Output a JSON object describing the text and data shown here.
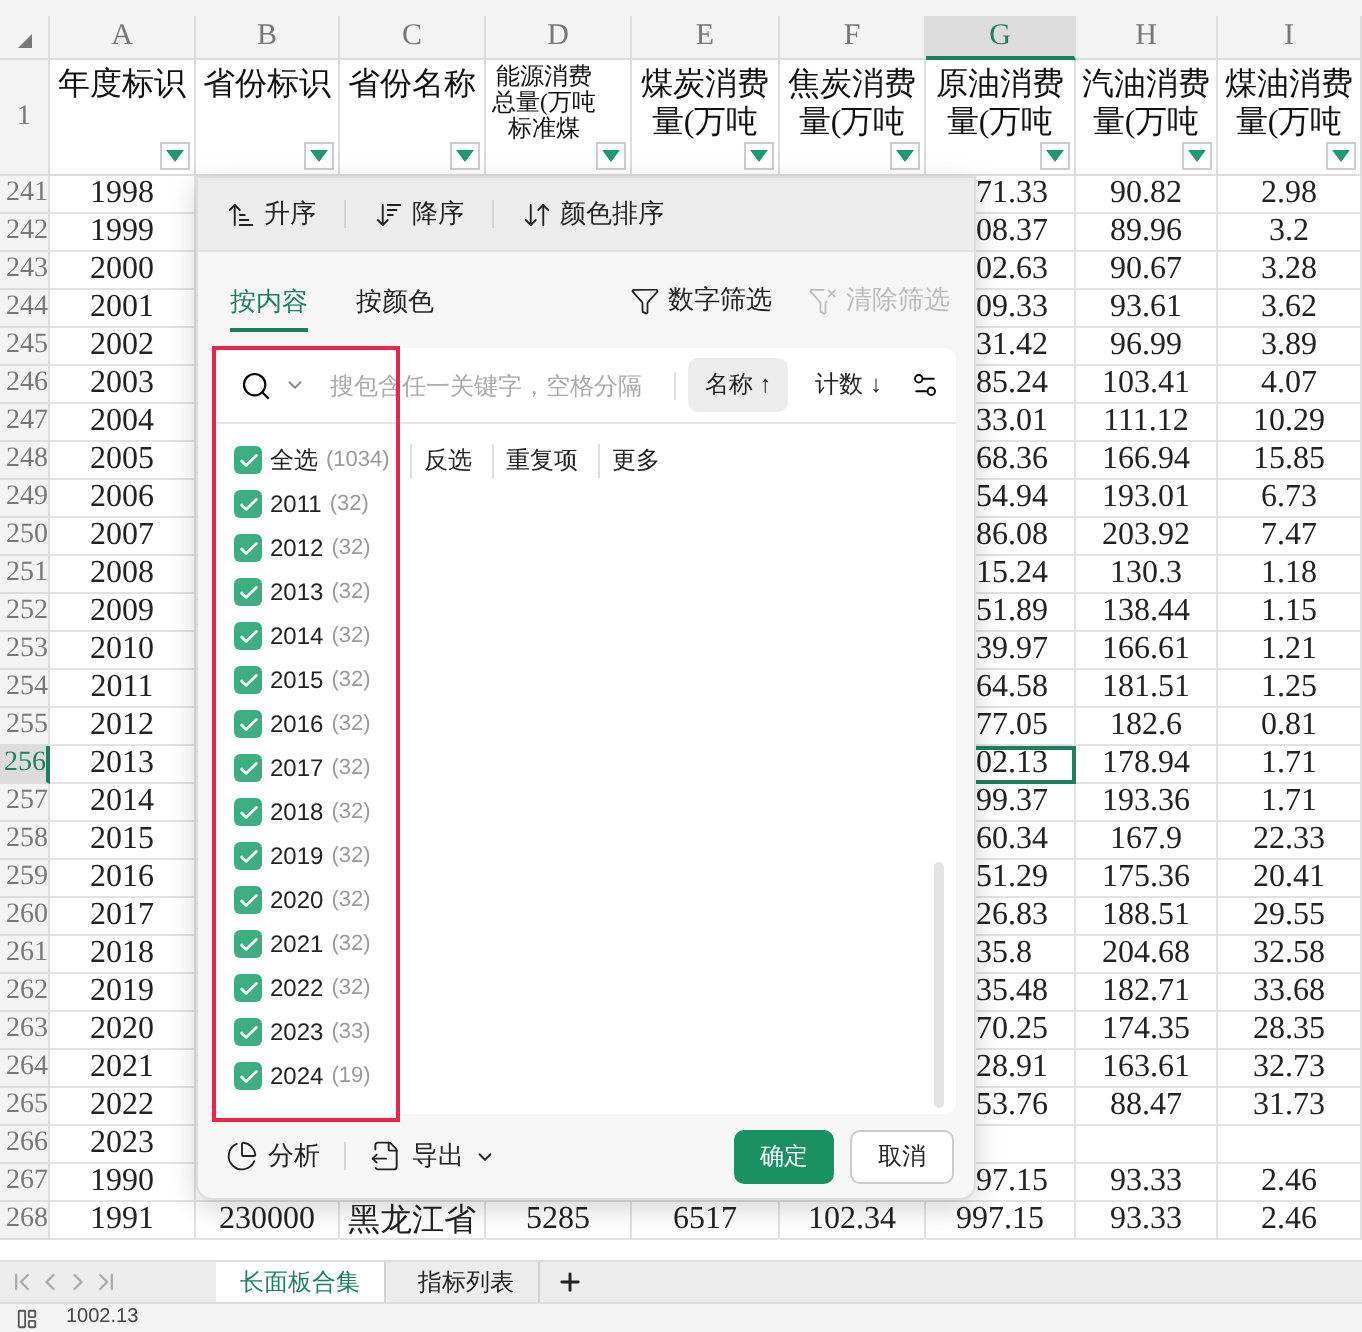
{
  "columns": [
    {
      "letter": "A",
      "selected": false
    },
    {
      "letter": "B",
      "selected": false
    },
    {
      "letter": "C",
      "selected": false
    },
    {
      "letter": "D",
      "selected": false
    },
    {
      "letter": "E",
      "selected": false
    },
    {
      "letter": "F",
      "selected": false
    },
    {
      "letter": "G",
      "selected": true
    },
    {
      "letter": "H",
      "selected": false
    },
    {
      "letter": "I",
      "selected": false
    }
  ],
  "header_row": {
    "number": "1",
    "cells": [
      "年度标识",
      "省份标识",
      "省份名称",
      "能源消费总量(万吨标准煤",
      "煤炭消费量(万吨",
      "焦炭消费量(万吨",
      "原油消费量(万吨",
      "汽油消费量(万吨",
      "煤油消费量(万吨"
    ]
  },
  "rows": [
    {
      "number": "241",
      "selected": false,
      "covered": true,
      "cells": {
        "A": "1998",
        "G": "71.33",
        "H": "90.82",
        "I": "2.98"
      }
    },
    {
      "number": "242",
      "selected": false,
      "covered": true,
      "cells": {
        "A": "1999",
        "G": "08.37",
        "H": "89.96",
        "I": "3.2"
      }
    },
    {
      "number": "243",
      "selected": false,
      "covered": true,
      "cells": {
        "A": "2000",
        "G": "02.63",
        "H": "90.67",
        "I": "3.28"
      }
    },
    {
      "number": "244",
      "selected": false,
      "covered": true,
      "cells": {
        "A": "2001",
        "G": "09.33",
        "H": "93.61",
        "I": "3.62"
      }
    },
    {
      "number": "245",
      "selected": false,
      "covered": true,
      "cells": {
        "A": "2002",
        "G": "31.42",
        "H": "96.99",
        "I": "3.89"
      }
    },
    {
      "number": "246",
      "selected": false,
      "covered": true,
      "cells": {
        "A": "2003",
        "G": "85.24",
        "H": "103.41",
        "I": "4.07"
      }
    },
    {
      "number": "247",
      "selected": false,
      "covered": true,
      "cells": {
        "A": "2004",
        "G": "33.01",
        "H": "111.12",
        "I": "10.29"
      }
    },
    {
      "number": "248",
      "selected": false,
      "covered": true,
      "cells": {
        "A": "2005",
        "G": "68.36",
        "H": "166.94",
        "I": "15.85"
      }
    },
    {
      "number": "249",
      "selected": false,
      "covered": true,
      "cells": {
        "A": "2006",
        "G": "54.94",
        "H": "193.01",
        "I": "6.73"
      }
    },
    {
      "number": "250",
      "selected": false,
      "covered": true,
      "cells": {
        "A": "2007",
        "G": "86.08",
        "H": "203.92",
        "I": "7.47"
      }
    },
    {
      "number": "251",
      "selected": false,
      "covered": true,
      "cells": {
        "A": "2008",
        "G": "15.24",
        "H": "130.3",
        "I": "1.18"
      }
    },
    {
      "number": "252",
      "selected": false,
      "covered": true,
      "cells": {
        "A": "2009",
        "G": "51.89",
        "H": "138.44",
        "I": "1.15"
      }
    },
    {
      "number": "253",
      "selected": false,
      "covered": true,
      "cells": {
        "A": "2010",
        "G": "39.97",
        "H": "166.61",
        "I": "1.21"
      }
    },
    {
      "number": "254",
      "selected": false,
      "covered": true,
      "cells": {
        "A": "2011",
        "G": "64.58",
        "H": "181.51",
        "I": "1.25"
      }
    },
    {
      "number": "255",
      "selected": false,
      "covered": true,
      "cells": {
        "A": "2012",
        "G": "77.05",
        "H": "182.6",
        "I": "0.81"
      }
    },
    {
      "number": "256",
      "selected": true,
      "covered": true,
      "cells": {
        "A": "2013",
        "G": "02.13",
        "H": "178.94",
        "I": "1.71"
      }
    },
    {
      "number": "257",
      "selected": false,
      "covered": true,
      "cells": {
        "A": "2014",
        "G": "99.37",
        "H": "193.36",
        "I": "1.71"
      }
    },
    {
      "number": "258",
      "selected": false,
      "covered": true,
      "cells": {
        "A": "2015",
        "G": "60.34",
        "H": "167.9",
        "I": "22.33"
      }
    },
    {
      "number": "259",
      "selected": false,
      "covered": true,
      "cells": {
        "A": "2016",
        "G": "51.29",
        "H": "175.36",
        "I": "20.41"
      }
    },
    {
      "number": "260",
      "selected": false,
      "covered": true,
      "cells": {
        "A": "2017",
        "G": "26.83",
        "H": "188.51",
        "I": "29.55"
      }
    },
    {
      "number": "261",
      "selected": false,
      "covered": true,
      "cells": {
        "A": "2018",
        "G": "35.8",
        "H": "204.68",
        "I": "32.58"
      }
    },
    {
      "number": "262",
      "selected": false,
      "covered": true,
      "cells": {
        "A": "2019",
        "G": "35.48",
        "H": "182.71",
        "I": "33.68"
      }
    },
    {
      "number": "263",
      "selected": false,
      "covered": true,
      "cells": {
        "A": "2020",
        "G": "70.25",
        "H": "174.35",
        "I": "28.35"
      }
    },
    {
      "number": "264",
      "selected": false,
      "covered": true,
      "cells": {
        "A": "2021",
        "G": "28.91",
        "H": "163.61",
        "I": "32.73"
      }
    },
    {
      "number": "265",
      "selected": false,
      "covered": true,
      "cells": {
        "A": "2022",
        "G": "53.76",
        "H": "88.47",
        "I": "31.73"
      }
    },
    {
      "number": "266",
      "selected": false,
      "covered": true,
      "cells": {
        "A": "2023"
      }
    },
    {
      "number": "267",
      "selected": false,
      "covered": true,
      "cells": {
        "A": "1990",
        "G": "97.15",
        "H": "93.33",
        "I": "2.46"
      }
    },
    {
      "number": "268",
      "selected": false,
      "covered": false,
      "cells": {
        "A": "1991",
        "B": "230000",
        "C": "黑龙江省",
        "D": "5285",
        "E": "6517",
        "F": "102.34",
        "G": "997.15",
        "H": "93.33",
        "I": "2.46"
      }
    }
  ],
  "filter_popup": {
    "sort_buttons": [
      "升序",
      "降序",
      "颜色排序"
    ],
    "tabs": [
      {
        "label": "按内容",
        "selected": true
      },
      {
        "label": "按颜色",
        "selected": false
      }
    ],
    "actions": [
      {
        "label": "数字筛选",
        "disabled": false
      },
      {
        "label": "清除筛选",
        "disabled": true
      }
    ],
    "search": {
      "placeholder": "搜包含任一关键字，空格分隔"
    },
    "order_buttons": [
      {
        "label": "名称 ↑",
        "selected": true
      },
      {
        "label": "计数 ↓",
        "selected": false
      }
    ],
    "select_all": {
      "label": "全选",
      "count": "(1034)",
      "checked": true
    },
    "list_links": [
      "反选",
      "重复项",
      "更多"
    ],
    "items": [
      {
        "label": "2011",
        "count": "(32)",
        "checked": true
      },
      {
        "label": "2012",
        "count": "(32)",
        "checked": true
      },
      {
        "label": "2013",
        "count": "(32)",
        "checked": true
      },
      {
        "label": "2014",
        "count": "(32)",
        "checked": true
      },
      {
        "label": "2015",
        "count": "(32)",
        "checked": true
      },
      {
        "label": "2016",
        "count": "(32)",
        "checked": true
      },
      {
        "label": "2017",
        "count": "(32)",
        "checked": true
      },
      {
        "label": "2018",
        "count": "(32)",
        "checked": true
      },
      {
        "label": "2019",
        "count": "(32)",
        "checked": true
      },
      {
        "label": "2020",
        "count": "(32)",
        "checked": true
      },
      {
        "label": "2021",
        "count": "(32)",
        "checked": true
      },
      {
        "label": "2022",
        "count": "(32)",
        "checked": true
      },
      {
        "label": "2023",
        "count": "(33)",
        "checked": true
      },
      {
        "label": "2024",
        "count": "(19)",
        "checked": true
      }
    ],
    "footer_tools": [
      "分析",
      "导出"
    ],
    "confirm": "确定",
    "cancel": "取消"
  },
  "sheet_tabs": [
    {
      "label": "长面板合集",
      "selected": true
    },
    {
      "label": "指标列表",
      "selected": false
    }
  ],
  "status_bar": {
    "value": "1002.13"
  }
}
